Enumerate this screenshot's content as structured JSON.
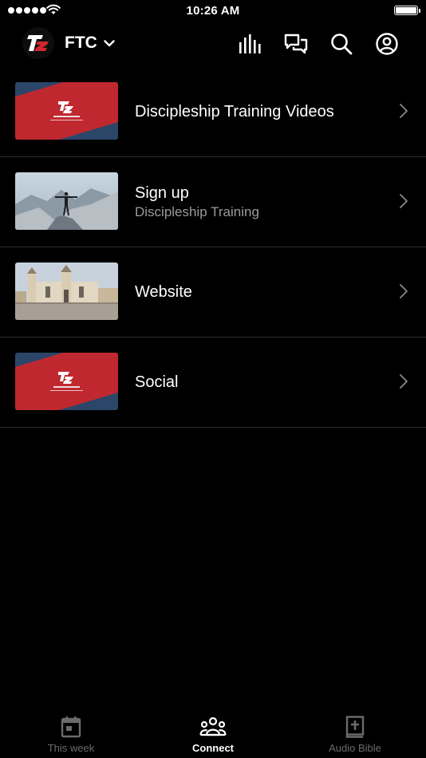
{
  "status_bar": {
    "time": "10:26 AM",
    "signal_icon": "signal-dots-icon",
    "wifi_icon": "wifi-icon",
    "battery_level": 1.0
  },
  "header": {
    "brand_name": "FTC",
    "logo_icon": "ftc-logo-icon",
    "icons": [
      "audio-bars-icon",
      "chat-bubbles-icon",
      "search-icon",
      "profile-icon"
    ]
  },
  "list": {
    "items": [
      {
        "title": "Discipleship Training Videos",
        "subtitle": "",
        "thumbnail": "feed-the-crave-banner"
      },
      {
        "title": "Sign up",
        "subtitle": "Discipleship Training",
        "thumbnail": "man-on-mountain-peak"
      },
      {
        "title": "Website",
        "subtitle": "",
        "thumbnail": "cathedral-plaza"
      },
      {
        "title": "Social",
        "subtitle": "",
        "thumbnail": "feed-the-crave-banner"
      }
    ]
  },
  "tabbar": {
    "tabs": [
      {
        "label": "This week",
        "icon": "calendar-icon",
        "active": false
      },
      {
        "label": "Connect",
        "icon": "people-group-icon",
        "active": true
      },
      {
        "label": "Audio Bible",
        "icon": "bible-plus-icon",
        "active": false
      }
    ]
  },
  "colors": {
    "background": "#000000",
    "separator": "#2e2e2e",
    "subtitle": "#9a9a9a",
    "tab_inactive": "#6b6b6b",
    "banner_red": "#c0282f",
    "banner_navy": "#2b4669"
  }
}
